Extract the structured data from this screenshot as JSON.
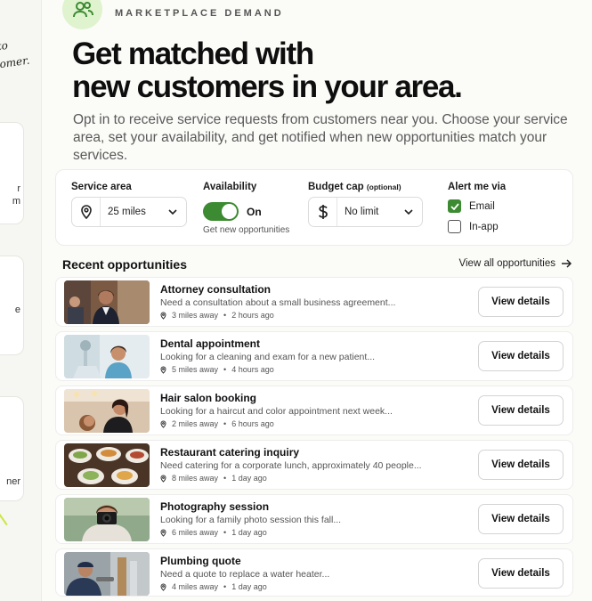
{
  "left": {
    "scribble_line1": "to",
    "scribble_line2": "omer.",
    "card1_a": "r",
    "card1_b": "m",
    "card2_a": "e",
    "card3_a": "ner"
  },
  "header": {
    "eyebrow": "MARKETPLACE DEMAND",
    "headline_line1": "Get matched with",
    "headline_line2": "new customers in your area.",
    "subtext": "Opt in to receive service requests from customers near you. Choose your service area, set your availability, and get notified when new opportunities match your services."
  },
  "settings": {
    "service_area_label": "Service area",
    "service_area_value": "25 miles",
    "availability_label": "Availability",
    "availability_state": "On",
    "availability_sub": "Get new opportunities",
    "budget_label": "Budget cap",
    "budget_optional": "(optional)",
    "budget_value": "No limit",
    "alert_label": "Alert me via",
    "alert_email": "Email",
    "alert_inapp": "In-app",
    "accent_color": "#3c8a31"
  },
  "recent": {
    "title": "Recent opportunities",
    "view_all": "View all opportunities",
    "button_label": "View details",
    "items": [
      {
        "title": "Attorney consultation",
        "desc": "Need a consultation about a small business agreement...",
        "distance": "3 miles away",
        "time": "2 hours ago",
        "thumb": "attorney"
      },
      {
        "title": "Dental appointment",
        "desc": "Looking for a cleaning and exam for a new patient...",
        "distance": "5 miles away",
        "time": "4 hours ago",
        "thumb": "dentist"
      },
      {
        "title": "Hair salon booking",
        "desc": "Looking for a haircut and color appointment next week...",
        "distance": "2 miles away",
        "time": "6 hours ago",
        "thumb": "salon"
      },
      {
        "title": "Restaurant catering inquiry",
        "desc": "Need catering for a corporate lunch, approximately 40 people...",
        "distance": "8 miles away",
        "time": "1 day ago",
        "thumb": "catering"
      },
      {
        "title": "Photography session",
        "desc": "Looking for a family photo session this fall...",
        "distance": "6 miles away",
        "time": "1 day ago",
        "thumb": "photographer"
      },
      {
        "title": "Plumbing quote",
        "desc": "Need a quote to replace a water heater...",
        "distance": "4 miles away",
        "time": "1 day ago",
        "thumb": "plumber"
      }
    ]
  }
}
